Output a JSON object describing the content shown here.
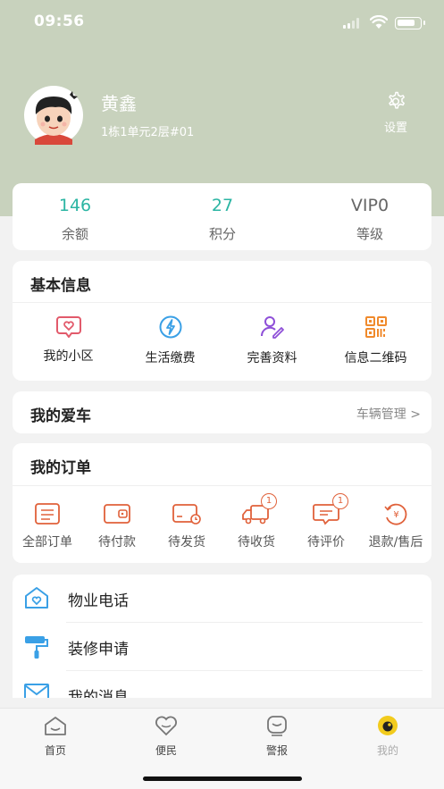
{
  "status_bar": {
    "time": "09:56"
  },
  "profile": {
    "name": "黄鑫",
    "address": "1栋1单元2层#01",
    "settings_label": "设置"
  },
  "stats": [
    {
      "value": "146",
      "label": "余额"
    },
    {
      "value": "27",
      "label": "积分"
    },
    {
      "value": "VIP0",
      "label": "等级"
    }
  ],
  "basic_info": {
    "title": "基本信息",
    "items": [
      {
        "label": "我的小区",
        "icon": "community-heart-icon"
      },
      {
        "label": "生活缴费",
        "icon": "bill-payment-icon"
      },
      {
        "label": "完善资料",
        "icon": "edit-profile-icon"
      },
      {
        "label": "信息二维码",
        "icon": "qr-code-icon"
      }
    ]
  },
  "car": {
    "title": "我的爱车",
    "link": "车辆管理 >"
  },
  "orders": {
    "title": "我的订单",
    "items": [
      {
        "label": "全部订单",
        "icon": "all-orders-icon",
        "badge": ""
      },
      {
        "label": "待付款",
        "icon": "wallet-icon",
        "badge": ""
      },
      {
        "label": "待发货",
        "icon": "card-clock-icon",
        "badge": ""
      },
      {
        "label": "待收货",
        "icon": "truck-icon",
        "badge": "1"
      },
      {
        "label": "待评价",
        "icon": "comment-icon",
        "badge": "1"
      },
      {
        "label": "退款/售后",
        "icon": "refund-icon",
        "badge": ""
      }
    ]
  },
  "menu": [
    {
      "label": "物业电话",
      "icon": "property-house-icon"
    },
    {
      "label": "装修申请",
      "icon": "paint-roller-icon"
    },
    {
      "label": "我的消息",
      "icon": "mail-icon"
    }
  ],
  "tabbar": [
    {
      "label": "首页",
      "icon": "home-tab-icon"
    },
    {
      "label": "便民",
      "icon": "heart-tab-icon"
    },
    {
      "label": "警报",
      "icon": "alarm-tab-icon"
    },
    {
      "label": "我的",
      "icon": "mine-tab-icon"
    }
  ],
  "colors": {
    "header_bg": "#c8d2bd",
    "accent_teal": "#2bb5a3",
    "order_orange": "#e0613a",
    "menu_blue": "#3aa0e6"
  }
}
